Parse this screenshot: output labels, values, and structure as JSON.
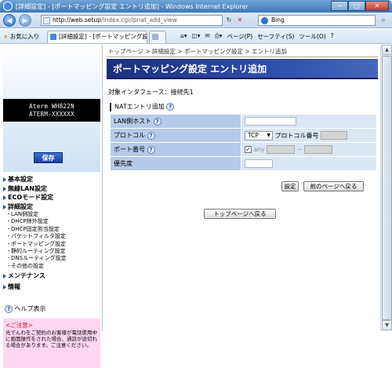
{
  "window": {
    "title": "[詳細設定] - [ポートマッピング設定 エントリ追加] - Windows Internet Explorer",
    "minimize": "─",
    "maximize": "□",
    "close": "✕"
  },
  "addressbar": {
    "host": "http://web.setup",
    "path": "/index.cgi/ipnat_add_view",
    "refresh": "↻",
    "stop": "✕",
    "search_placeholder": "Bing",
    "back": "◀",
    "forward": "▶"
  },
  "commandbar": {
    "favorites": "お気に入り",
    "tab1": "[詳細設定] - [ポートマッピング設...",
    "tab2": "",
    "page_menu": "ページ(P)",
    "safety_menu": "セーフティ(S)",
    "tools_menu": "ツール(O)",
    "help_menu": "?"
  },
  "sidebar": {
    "model_line1": "Aterm WH822N",
    "model_line2": "ATERM-XXXXXX",
    "save_label": "保存",
    "sections": [
      {
        "label": "基本設定"
      },
      {
        "label": "無線LAN設定"
      },
      {
        "label": "ECOモード設定"
      },
      {
        "label": "詳細設定"
      }
    ],
    "detail_items": [
      "LAN側設定",
      "DHCP除外設定",
      "DHCP固定割当設定",
      "パケットフィルタ設定",
      "ポートマッピング設定",
      "静的ルーティング設定",
      "DNSルーティング設定",
      "その他の設定"
    ],
    "maintenance": "メンテナンス",
    "info": "情報",
    "help": "ヘルプ表示",
    "notice_title": "<ご注意>",
    "notice_body": "光でんわをご契約のお客様が電話使用中に画面操作をされた場合、通話が途切れる場合があります。ご注意ください。"
  },
  "content": {
    "breadcrumb": "トップページ > 詳細設定 > ポートマッピング設定 > エントリ追加",
    "title": "ポートマッピング設定 エントリ追加",
    "interface": "対象インタフェース：接続先1",
    "section_title": "NATエントリ追加",
    "rows": {
      "lan_host": "LAN側ホスト",
      "protocol": "プロトコル",
      "protocol_value": "TCP",
      "protocol_number": "プロトコル番号",
      "port": "ポート番号",
      "port_any": "any",
      "port_dash": "－",
      "priority": "優先度"
    },
    "set_button": "設定",
    "back_button": "前のページへ戻る",
    "top_button": "トップページへ戻る"
  }
}
